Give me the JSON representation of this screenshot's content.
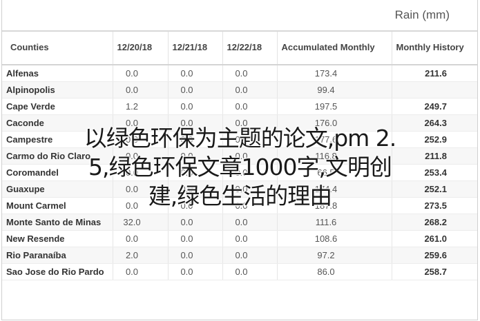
{
  "header": {
    "title": "Rain (mm)"
  },
  "table": {
    "columns": [
      "Counties",
      "12/20/18",
      "12/21/18",
      "12/22/18",
      "Accumulated Monthly",
      "Monthly History"
    ],
    "rows": [
      [
        "Alfenas",
        "0.0",
        "0.0",
        "0.0",
        "173.4",
        "211.6"
      ],
      [
        "Alpinopolis",
        "0.0",
        "0.0",
        "0.0",
        "99.4",
        ""
      ],
      [
        "Cape Verde",
        "1.2",
        "0.0",
        "0.0",
        "197.5",
        "249.7"
      ],
      [
        "Caconde",
        "0.0",
        "0.0",
        "0.0",
        "176.0",
        "264.3"
      ],
      [
        "Campestre",
        "0.0",
        "0.0",
        "0.0",
        "177.6",
        "252.9"
      ],
      [
        "Carmo do Rio Claro",
        "0.0",
        "0.0",
        "0.0",
        "116.8",
        "211.8"
      ],
      [
        "Coromandel",
        "0.0",
        "0.0",
        "0.0",
        "66.5",
        "253.4"
      ],
      [
        "Guaxupe",
        "0.0",
        "0.0",
        "0.0",
        "174.4",
        "252.1"
      ],
      [
        "Mount Carmel",
        "0.0",
        "0.0",
        "0.0",
        "187.8",
        "273.5"
      ],
      [
        "Monte Santo de Minas",
        "32.0",
        "0.0",
        "0.0",
        "111.6",
        "268.2"
      ],
      [
        "New Resende",
        "0.0",
        "0.0",
        "0.0",
        "108.6",
        "261.0"
      ],
      [
        "Rio Paranaíba",
        "2.0",
        "0.0",
        "0.0",
        "97.2",
        "259.6"
      ],
      [
        "Sao Jose do Rio Pardo",
        "0.0",
        "0.0",
        "0.0",
        "86.0",
        "258.7"
      ]
    ]
  },
  "overlay": {
    "line1": "以绿色环保为主题的论文,pm 2.",
    "line2": "5,绿色环保文章1000字,文明创",
    "line3": "建,绿色生活的理由"
  }
}
